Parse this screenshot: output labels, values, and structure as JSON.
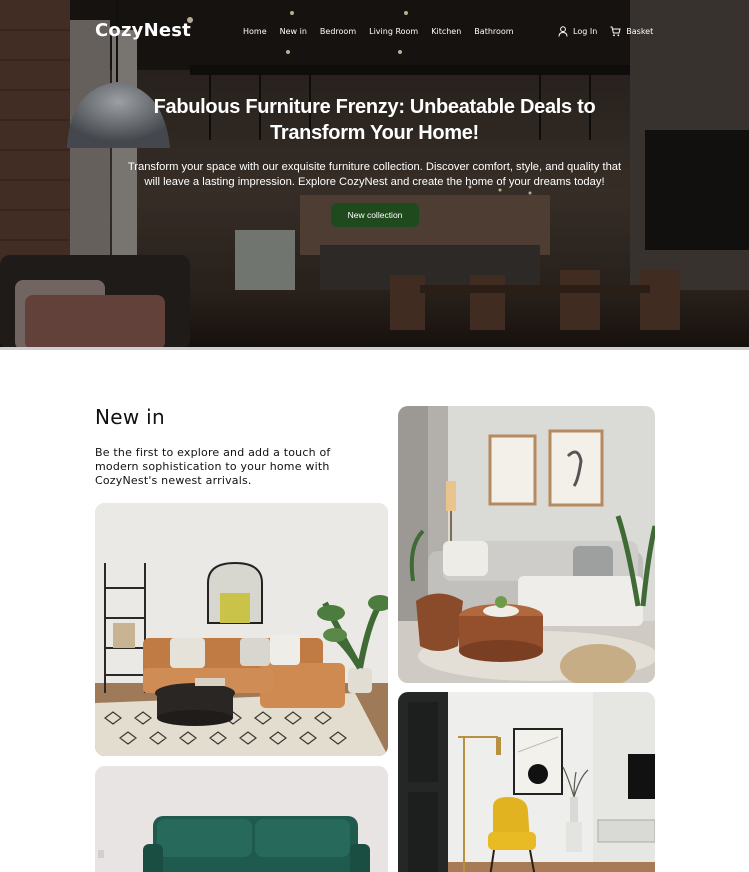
{
  "brand": "CozyNest",
  "nav": {
    "links": [
      "Home",
      "New in",
      "Bedroom",
      "Living Room",
      "Kitchen",
      "Bathroom"
    ],
    "login": "Log In",
    "basket": "Basket"
  },
  "hero": {
    "title": "Fabulous Furniture Frenzy: Unbeatable Deals to Transform Your Home!",
    "subtitle": "Transform your space with our exquisite furniture collection. Discover comfort, style, and quality that will leave a lasting impression. Explore CozyNest and create the home of your dreams today!",
    "cta": "New collection"
  },
  "new_in": {
    "title": "New in",
    "description": "Be the first to explore and add a touch of modern sophistication to your home with CozyNest's newest arrivals."
  },
  "icons": {
    "login": "user-icon",
    "basket": "cart-icon"
  },
  "colors": {
    "cta_green": "#1f4a1e",
    "hero_text": "#ffffff",
    "body_text": "#111111"
  }
}
